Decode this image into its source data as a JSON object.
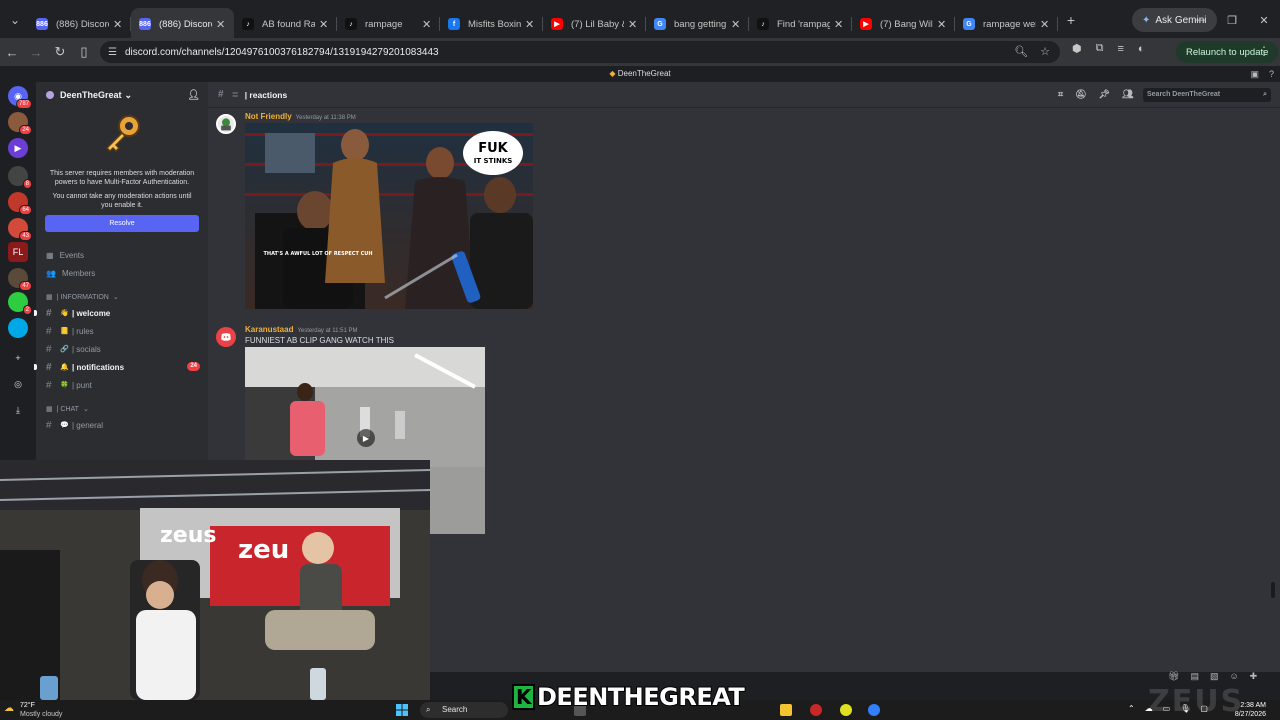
{
  "browser": {
    "tabs": [
      {
        "title": "(886) Discord |",
        "fav_color": "#5865f2",
        "fav_label": "886",
        "active": false
      },
      {
        "title": "(886) Discord |",
        "fav_color": "#5865f2",
        "fav_label": "886",
        "active": true
      },
      {
        "title": "AB found Ramp",
        "fav_color": "#111111",
        "fav_label": "♪",
        "active": false
      },
      {
        "title": "rampage",
        "fav_color": "#111111",
        "fav_label": "♪",
        "active": false
      },
      {
        "title": "Misfits Boxing",
        "fav_color": "#1877f2",
        "fav_label": "f",
        "active": false
      },
      {
        "title": "(7) Lil Baby & 4",
        "fav_color": "#ff0000",
        "fav_label": "▶",
        "active": false
      },
      {
        "title": "bang getting cl",
        "fav_color": "#4285f4",
        "fav_label": "G",
        "active": false
      },
      {
        "title": "Find 'rampage'",
        "fav_color": "#111111",
        "fav_label": "♪",
        "active": false
      },
      {
        "title": "(7) Bang William",
        "fav_color": "#ff0000",
        "fav_label": "▶",
        "active": false
      },
      {
        "title": "rampage weigh",
        "fav_color": "#4285f4",
        "fav_label": "G",
        "active": false
      }
    ],
    "gemini_label": "Ask Gemini",
    "url": "discord.com/channels/1204976100376182794/1319194279201083443",
    "relaunch_label": "Relaunch to update"
  },
  "discord": {
    "window_title": "DeenTheGreat",
    "server_rail": [
      {
        "color": "#5865f2",
        "badge": "787",
        "glyph": "◉"
      },
      {
        "color": "#8a5a3c",
        "badge": "24",
        "glyph": ""
      },
      {
        "color": "#6b3fd4",
        "badge": "",
        "glyph": "▶"
      },
      {
        "color": "#444444",
        "badge": "8",
        "glyph": ""
      },
      {
        "color": "#c0392b",
        "badge": "64",
        "glyph": ""
      },
      {
        "color": "#d44a3a",
        "badge": "43",
        "glyph": ""
      },
      {
        "color": "#8b1a1a",
        "badge": "",
        "glyph": "FL"
      },
      {
        "color": "#5a4a3a",
        "badge": "47",
        "glyph": ""
      },
      {
        "color": "#2ecc40",
        "badge": "2",
        "glyph": ""
      },
      {
        "color": "#00a8e8",
        "badge": "",
        "glyph": ""
      }
    ],
    "rail_actions": [
      "+",
      "◎",
      "⤓"
    ],
    "guild_name": "DeenTheGreat",
    "mfa_notice_1": "This server requires members with moderation powers to have Multi-Factor Authentication.",
    "mfa_notice_2": "You cannot take any moderation actions until you enable it.",
    "resolve_label": "Resolve",
    "nav": [
      {
        "label": "Events",
        "icon": "▦"
      },
      {
        "label": "Members",
        "icon": "👥"
      }
    ],
    "categories": [
      {
        "name": "| INFORMATION",
        "channels": [
          {
            "name": "| welcome",
            "emoji": "👋",
            "unread": true,
            "mention": ""
          },
          {
            "name": "| rules",
            "emoji": "📒",
            "unread": false,
            "mention": ""
          },
          {
            "name": "| socials",
            "emoji": "🔗",
            "unread": false,
            "mention": ""
          },
          {
            "name": "| notifications",
            "emoji": "🔔",
            "unread": true,
            "mention": "24"
          },
          {
            "name": "| punt",
            "emoji": "🍀",
            "unread": false,
            "mention": ""
          }
        ]
      },
      {
        "name": "| CHAT",
        "channels": [
          {
            "name": "| general",
            "emoji": "💬",
            "unread": false,
            "mention": ""
          }
        ]
      }
    ],
    "channel_header": "| reactions",
    "search_placeholder": "Search DeenTheGreat",
    "messages": [
      {
        "author": "Not Friendly",
        "timestamp": "Yesterday at 11:38 PM",
        "text": "",
        "attachment_caption_1": "FUK",
        "attachment_caption_2": "IT STINKS",
        "attachment_shirt": "THAT'S A AWFUL LOT OF RESPECT CUH"
      },
      {
        "author": "Karanustaad",
        "timestamp": "Yesterday at 11:51 PM",
        "text": "FUNNIEST AB CLIP GANG WATCH THIS"
      }
    ]
  },
  "taskbar": {
    "temp": "72°F",
    "condition": "Mostly cloudy",
    "search_label": "Search",
    "time": "2:38 AM",
    "date": "8/27/2026"
  },
  "overlay": {
    "streamer_tag": "DEENTHEGREAT",
    "tag_initial": "K",
    "watermark": "ZEUS"
  },
  "webcam": {
    "banner_text_1": "zeus",
    "banner_text_2": "zeu"
  }
}
